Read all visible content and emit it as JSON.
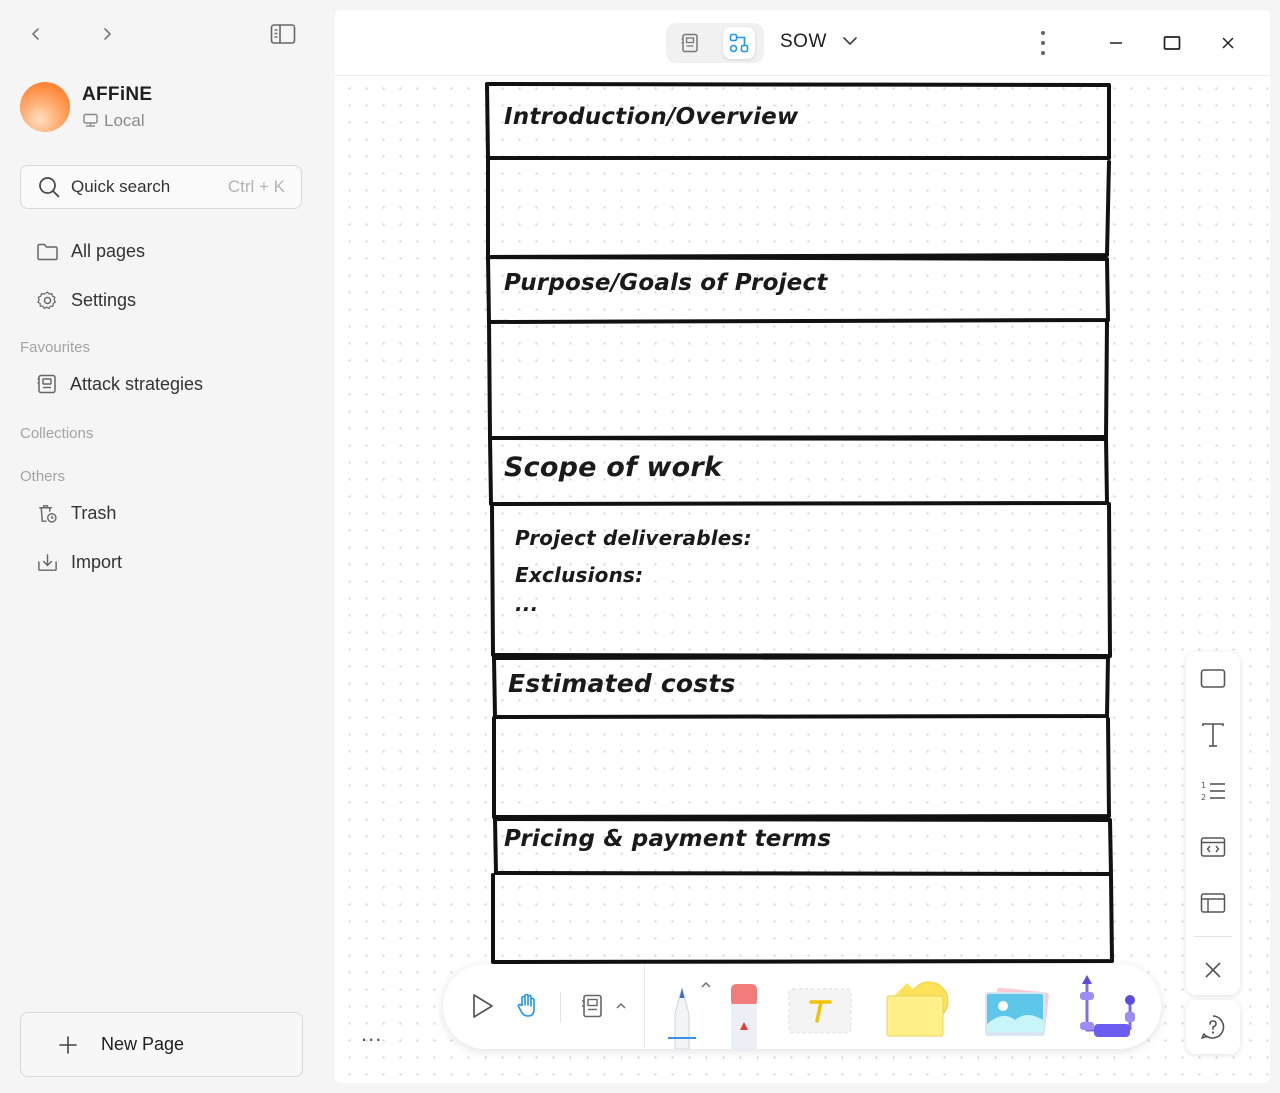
{
  "sidebar": {
    "workspace": {
      "name": "AFFiNE",
      "type": "Local"
    },
    "search": {
      "label": "Quick search",
      "shortcut": "Ctrl + K"
    },
    "nav": {
      "all_pages": "All pages",
      "settings": "Settings"
    },
    "sections": {
      "favourites": "Favourites",
      "collections": "Collections",
      "others": "Others"
    },
    "favourites": [
      {
        "label": "Attack strategies"
      }
    ],
    "others": {
      "trash": "Trash",
      "import": "Import"
    },
    "new_page": "New Page"
  },
  "header": {
    "title": "SOW",
    "mode": "edgeless"
  },
  "document": {
    "sections": [
      {
        "title": "Introduction/Overview"
      },
      {
        "title": "Purpose/Goals of Project"
      },
      {
        "title": "Scope of work",
        "lines": [
          "Project deliverables:",
          "Exclusions:",
          "..."
        ]
      },
      {
        "title": "Estimated costs"
      },
      {
        "title": "Pricing & payment terms"
      }
    ]
  },
  "more_label": "...",
  "colors": {
    "accent": "#1e96eb",
    "sidebar_bg": "#f5f5f5",
    "avatar": "#ff8a3d",
    "sticky": "#ffe96b"
  },
  "icons": {
    "left_toolbar": [
      "rectangle-icon",
      "text-icon",
      "numbered-list-icon",
      "code-block-icon",
      "layout-icon",
      "close-icon"
    ],
    "bottom_toolbar": [
      "select-icon",
      "hand-icon",
      "note-icon",
      "pen-icon",
      "eraser-icon",
      "text-tool-icon",
      "shape-icon",
      "image-icon",
      "connector-icon"
    ]
  }
}
